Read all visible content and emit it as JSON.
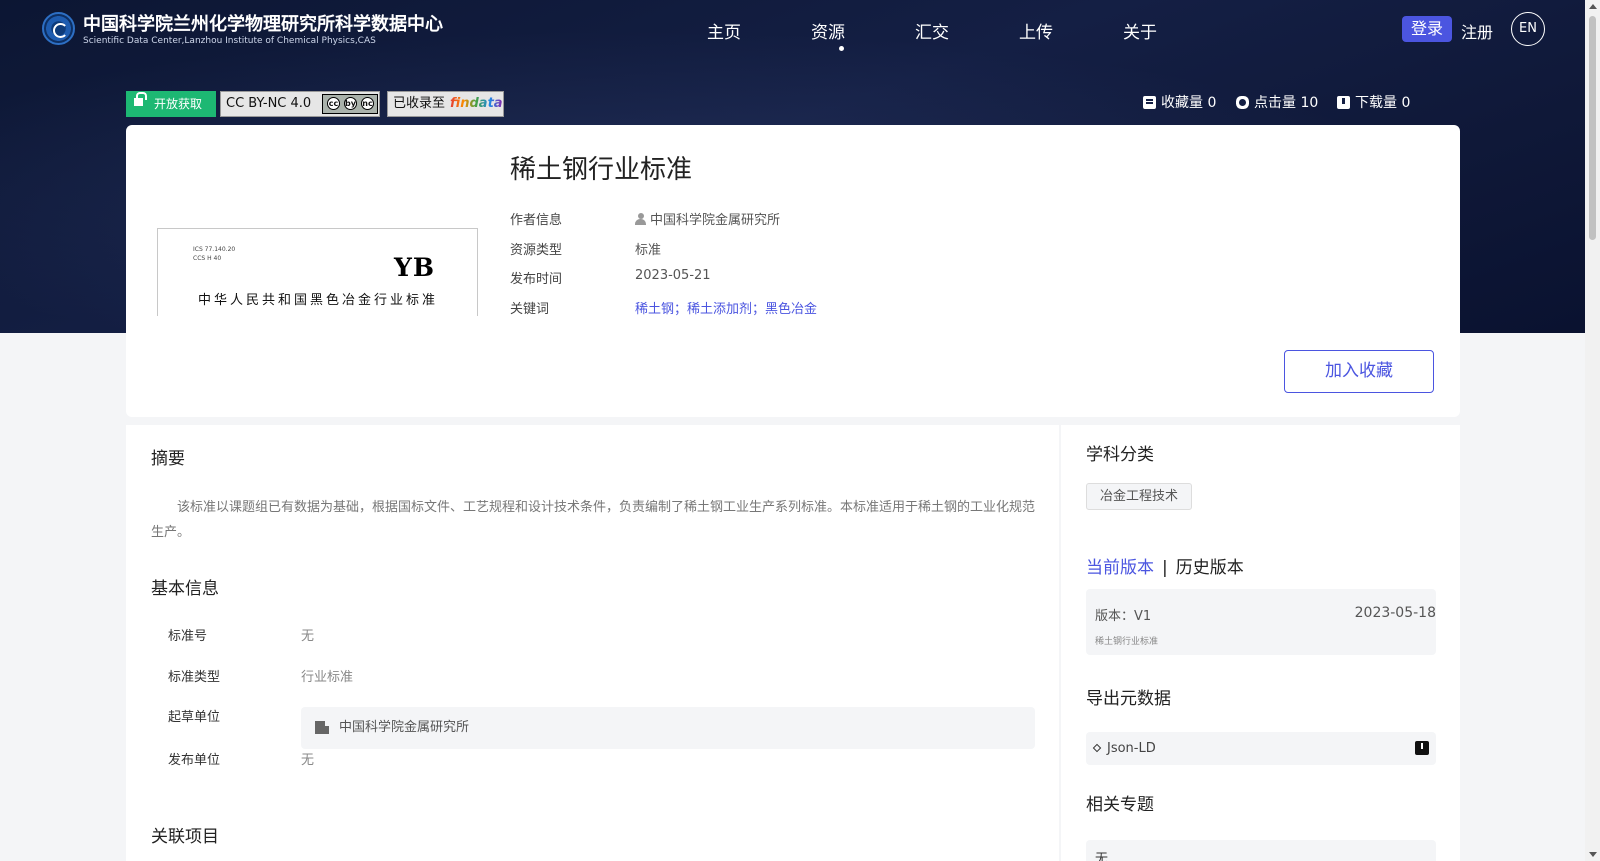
{
  "header": {
    "brand_title": "中国科学院兰州化学物理研究所科学数据中心",
    "brand_subtitle": "Scientific Data Center,Lanzhou Institute of Chemical Physics,CAS",
    "nav": [
      "主页",
      "资源",
      "汇交",
      "上传",
      "关于"
    ],
    "active_nav": "资源",
    "login": "登录",
    "register": "注册",
    "lang": "EN"
  },
  "badges": {
    "open_access": "开放获取",
    "license": "CC BY-NC 4.0",
    "license_icons": [
      "cc",
      "by",
      "nc"
    ],
    "findata_prefix": "已收录至",
    "findata_logo": "findata"
  },
  "stats": {
    "favorites": "收藏量 0",
    "views": "点击量 10",
    "downloads": "下载量 0"
  },
  "resource": {
    "title": "稀土钢行业标准",
    "thumb_code": "ICS 77.140.20\nCCS H 40",
    "thumb_yb": "YB",
    "thumb_caption": "中华人民共和国黑色冶金行业标准",
    "author_label": "作者信息",
    "author": "中国科学院金属研究所",
    "type_label": "资源类型",
    "type": "标准",
    "date_label": "发布时间",
    "date": "2023-05-21",
    "keywords_label": "关键词",
    "keywords": "稀土钢；稀土添加剂；黑色冶金",
    "favorite_button": "加入收藏"
  },
  "main": {
    "abstract_title": "摘要",
    "abstract": "该标准以课题组已有数据为基础，根据国标文件、工艺规程和设计技术条件，负责编制了稀土钢工业生产系列标准。本标准适用于稀土钢的工业化规范生产。",
    "basic_title": "基本信息",
    "fields": [
      {
        "label": "标准号",
        "value": "无"
      },
      {
        "label": "标准类型",
        "value": "行业标准"
      },
      {
        "label": "起草单位",
        "value": "中国科学院金属研究所"
      },
      {
        "label": "发布单位",
        "value": "无"
      }
    ],
    "related_projects_title": "关联项目"
  },
  "side": {
    "subject_title": "学科分类",
    "subject_tag": "冶金工程技术",
    "current_version": "当前版本",
    "separator": "|",
    "history_version": "历史版本",
    "version_label": "版本：V1",
    "version_date": "2023-05-18",
    "version_name": "稀土钢行业标准",
    "export_title": "导出元数据",
    "export_format": "Json-LD",
    "related_topics_title": "相关专题",
    "related_topics_value": "无"
  },
  "colors": {
    "accent": "#4b55e0",
    "open_access": "#1db873",
    "hero_bg": "#141f44"
  }
}
